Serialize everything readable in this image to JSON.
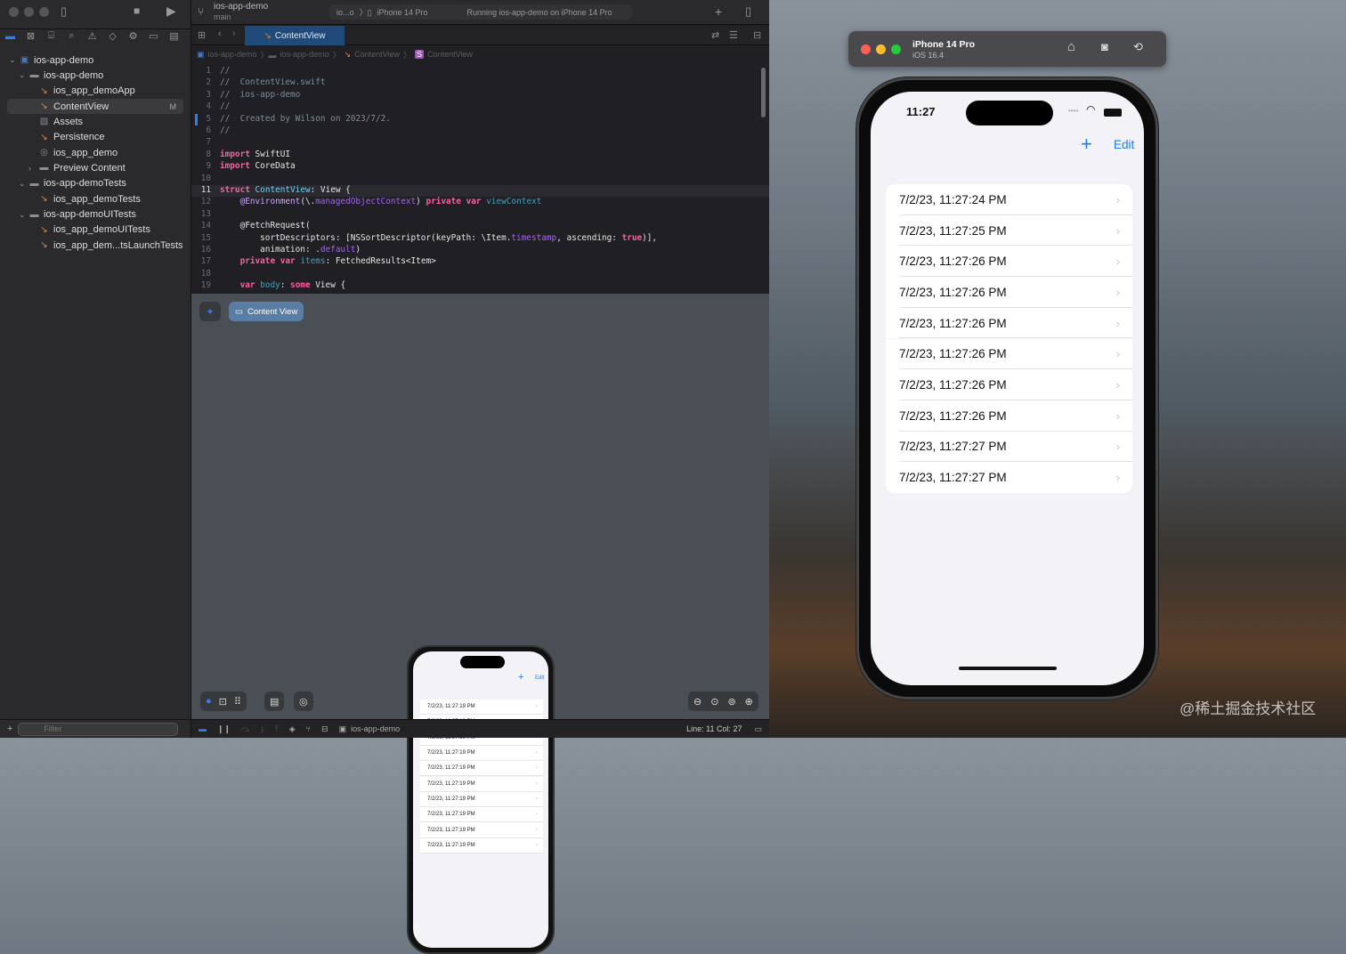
{
  "toolbar": {
    "project": "ios-app-demo",
    "branch": "main",
    "scheme": "io...o",
    "device": "iPhone 14 Pro",
    "status": "Running ios-app-demo on iPhone 14 Pro"
  },
  "tab": {
    "label": "ContentView"
  },
  "breadcrumb": [
    "ios-app-demo",
    "ios-app-demo",
    "ContentView",
    "ContentView"
  ],
  "navigator": {
    "items": [
      {
        "label": "ios-app-demo",
        "icon": "project-icon",
        "indent": 0,
        "chevron": "v"
      },
      {
        "label": "ios-app-demo",
        "icon": "folder-icon",
        "indent": 1,
        "chevron": "v"
      },
      {
        "label": "ios_app_demoApp",
        "icon": "swift-file-icon",
        "indent": 2
      },
      {
        "label": "ContentView",
        "icon": "swift-file-icon",
        "indent": 2,
        "selected": true,
        "badge": "M"
      },
      {
        "label": "Assets",
        "icon": "asset-catalog-icon",
        "indent": 2
      },
      {
        "label": "Persistence",
        "icon": "swift-file-icon",
        "indent": 2
      },
      {
        "label": "ios_app_demo",
        "icon": "data-model-icon",
        "indent": 2
      },
      {
        "label": "Preview Content",
        "icon": "folder-icon",
        "indent": 2,
        "chevron": ">"
      },
      {
        "label": "ios-app-demoTests",
        "icon": "folder-icon",
        "indent": 1,
        "chevron": "v"
      },
      {
        "label": "ios_app_demoTests",
        "icon": "swift-file-icon",
        "indent": 2
      },
      {
        "label": "ios-app-demoUITests",
        "icon": "folder-icon",
        "indent": 1,
        "chevron": "v"
      },
      {
        "label": "ios_app_demoUITests",
        "icon": "swift-file-icon",
        "indent": 2
      },
      {
        "label": "ios_app_dem...tsLaunchTests",
        "icon": "swift-file-icon",
        "indent": 2
      }
    ],
    "filter_placeholder": "Filter"
  },
  "code": {
    "current_line": 11,
    "lines": [
      [
        [
          "//",
          "comment"
        ]
      ],
      [
        [
          "//  ContentView.swift",
          "comment"
        ]
      ],
      [
        [
          "//  ios-app-demo",
          "comment"
        ]
      ],
      [
        [
          "//",
          "comment"
        ]
      ],
      [
        [
          "//  Created by Wilson on 2023/7/2.",
          "comment"
        ]
      ],
      [
        [
          "//",
          "comment"
        ]
      ],
      [],
      [
        [
          "import",
          "kw"
        ],
        [
          " SwiftUI",
          "plain"
        ]
      ],
      [
        [
          "import",
          "kw"
        ],
        [
          " CoreData",
          "plain"
        ]
      ],
      [],
      [
        [
          "struct",
          "kw"
        ],
        [
          " ",
          "plain"
        ],
        [
          "ContentView",
          "type"
        ],
        [
          ": View {",
          "plain"
        ]
      ],
      [
        [
          "    @Environment",
          "attr"
        ],
        [
          "(\\.",
          "plain"
        ],
        [
          "managedObjectContext",
          "prop"
        ],
        [
          ") ",
          "plain"
        ],
        [
          "private",
          "kw"
        ],
        [
          " ",
          "plain"
        ],
        [
          "var",
          "kw"
        ],
        [
          " ",
          "plain"
        ],
        [
          "viewContext",
          "var"
        ]
      ],
      [],
      [
        [
          "    @FetchRequest(",
          "plain"
        ]
      ],
      [
        [
          "        sortDescriptors: [NSSortDescriptor(keyPath: \\Item.",
          "plain"
        ],
        [
          "timestamp",
          "prop"
        ],
        [
          ", ascending: ",
          "plain"
        ],
        [
          "true",
          "kw"
        ],
        [
          ")],",
          "plain"
        ]
      ],
      [
        [
          "        animation: .",
          "plain"
        ],
        [
          "default",
          "prop"
        ],
        [
          ")",
          "plain"
        ]
      ],
      [
        [
          "    ",
          "plain"
        ],
        [
          "private",
          "kw"
        ],
        [
          " ",
          "plain"
        ],
        [
          "var",
          "kw"
        ],
        [
          " ",
          "plain"
        ],
        [
          "items",
          "var"
        ],
        [
          ": FetchedResults<Item>",
          "plain"
        ]
      ],
      [],
      [
        [
          "    ",
          "plain"
        ],
        [
          "var",
          "kw"
        ],
        [
          " ",
          "plain"
        ],
        [
          "body",
          "var"
        ],
        [
          ": ",
          "plain"
        ],
        [
          "some",
          "kw"
        ],
        [
          " View {",
          "plain"
        ]
      ]
    ]
  },
  "preview": {
    "label": "Content View",
    "items": [
      "7/2/23, 11:27:19 PM",
      "7/2/23, 11:27:19 PM",
      "7/2/23, 11:27:19 PM",
      "7/2/23, 11:27:19 PM",
      "7/2/23, 11:27:19 PM",
      "7/2/23, 11:27:19 PM",
      "7/2/23, 11:27:19 PM",
      "7/2/23, 11:27:19 PM",
      "7/2/23, 11:27:19 PM",
      "7/2/23, 11:27:19 PM"
    ],
    "edit": "Edit"
  },
  "statusbar": {
    "scheme": "ios-app-demo",
    "position": "Line: 11  Col: 27"
  },
  "simulator": {
    "device": "iPhone 14 Pro",
    "os": "iOS 16.4",
    "time": "11:27",
    "edit": "Edit",
    "items": [
      "7/2/23, 11:27:24 PM",
      "7/2/23, 11:27:25 PM",
      "7/2/23, 11:27:26 PM",
      "7/2/23, 11:27:26 PM",
      "7/2/23, 11:27:26 PM",
      "7/2/23, 11:27:26 PM",
      "7/2/23, 11:27:26 PM",
      "7/2/23, 11:27:26 PM",
      "7/2/23, 11:27:27 PM",
      "7/2/23, 11:27:27 PM"
    ]
  },
  "watermark": "@稀土掘金技术社区",
  "colors": {
    "accent": "#1a7cf4",
    "tab_active": "#1f4a7a"
  }
}
